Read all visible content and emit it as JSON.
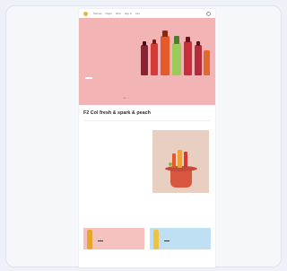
{
  "nav": {
    "links": [
      "Sitemap",
      "Pages",
      "Shop",
      "Sign in",
      "Cart"
    ]
  },
  "hero": {
    "title": "",
    "subtitle": "",
    "button": "",
    "colors": {
      "background": "#f2b4b4",
      "accent": "#d63a36"
    }
  },
  "intro": {
    "title": "F2 Col fresh & spark & peach",
    "text": ""
  },
  "feature": {
    "kicker": "",
    "title": "",
    "text": "",
    "link": ""
  },
  "cards": [
    {
      "title": "",
      "button": ""
    },
    {
      "title": "",
      "button": ""
    }
  ],
  "more_link": ""
}
